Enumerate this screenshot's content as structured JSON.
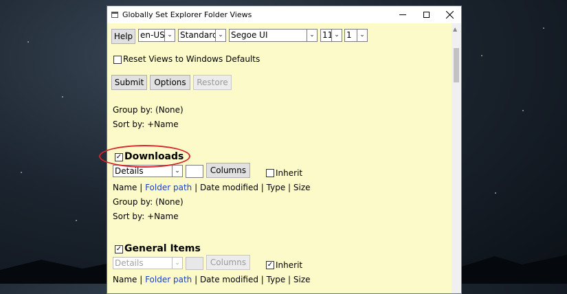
{
  "window": {
    "title": "Globally Set Explorer Folder Views"
  },
  "toolbar": {
    "help_label": "Help",
    "locale": "en-US",
    "style": "Standard",
    "font": "Segoe UI",
    "font_size": "11",
    "level": "1"
  },
  "reset": {
    "label": "Reset Views to Windows Defaults",
    "checked": false
  },
  "actions": {
    "submit": "Submit",
    "options": "Options",
    "restore": "Restore"
  },
  "global": {
    "group_by": "Group by: (None)",
    "sort_by": "Sort by: +Name"
  },
  "downloads": {
    "title": "Downloads",
    "checked": true,
    "view": "Details",
    "columns_label": "Columns",
    "inherit_label": "Inherit",
    "inherit_checked": false,
    "cols": {
      "name": "Name",
      "folder_path": "Folder path",
      "date": "Date modified",
      "type": "Type",
      "size": "Size"
    },
    "group_by": "Group by: (None)",
    "sort_by": "Sort by: +Name"
  },
  "general": {
    "title": "General Items",
    "checked": true,
    "view": "Details",
    "columns_label": "Columns",
    "inherit_label": "Inherit",
    "inherit_checked": true,
    "cols": {
      "name": "Name",
      "folder_path": "Folder path",
      "date": "Date modified",
      "type": "Type",
      "size": "Size"
    }
  },
  "glyphs": {
    "check": "✓",
    "dropdown": "⌄"
  },
  "colors": {
    "client_bg": "#fdfac9",
    "link": "#1a3fc4",
    "highlight_oval": "#d8232a"
  }
}
